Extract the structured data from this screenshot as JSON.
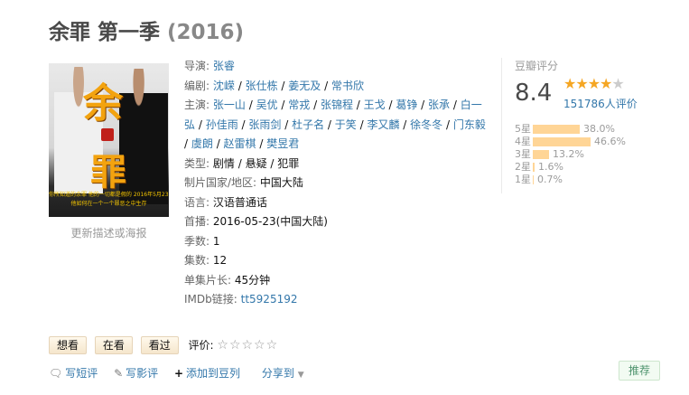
{
  "title": {
    "main": "余罪 第一季",
    "year": "(2016)"
  },
  "poster": {
    "glyph_top": "余",
    "glyph_bottom": "罪",
    "strip_line1": "你所知道的余罪 他的一切都是假的 2016年5月23日",
    "strip_line2": "他如何在一个一个罪恶之中生存",
    "link_text": "更新描述或海报"
  },
  "info": {
    "director_label": "导演:",
    "directors": [
      "张睿"
    ],
    "writer_label": "编剧:",
    "writers": [
      "沈嵘",
      "张仕栋",
      "姜无及",
      "常书欣"
    ],
    "cast_label": "主演:",
    "cast": [
      "张一山",
      "吴优",
      "常戎",
      "张锦程",
      "王戈",
      "葛铮",
      "张承",
      "白一弘",
      "孙佳雨",
      "张雨剑",
      "杜子名",
      "于笑",
      "李又麟",
      "徐冬冬",
      "门东毅",
      "虞朗",
      "赵雷棋",
      "樊昱君"
    ],
    "genre_label": "类型:",
    "genres": [
      "剧情",
      "悬疑",
      "犯罪"
    ],
    "country_label": "制片国家/地区:",
    "country": "中国大陆",
    "language_label": "语言:",
    "language": "汉语普通话",
    "premiere_label": "首播:",
    "premiere": "2016-05-23(中国大陆)",
    "seasons_label": "季数:",
    "seasons": "1",
    "episodes_label": "集数:",
    "episodes": "12",
    "runtime_label": "单集片长:",
    "runtime": "45分钟",
    "imdb_label": "IMDb链接:",
    "imdb": "tt5925192"
  },
  "rating": {
    "label": "豆瓣评分",
    "score": "8.4",
    "stars_filled": 4,
    "stars_total": 5,
    "count_text": "151786人评价",
    "distribution": [
      {
        "level": "5星",
        "percent": 38.0,
        "percent_text": "38.0%"
      },
      {
        "level": "4星",
        "percent": 46.6,
        "percent_text": "46.6%"
      },
      {
        "level": "3星",
        "percent": 13.2,
        "percent_text": "13.2%"
      },
      {
        "level": "2星",
        "percent": 1.6,
        "percent_text": "1.6%"
      },
      {
        "level": "1星",
        "percent": 0.7,
        "percent_text": "0.7%"
      }
    ]
  },
  "actions": {
    "want": "想看",
    "watching": "在看",
    "watched": "看过",
    "rate_label": "评价:",
    "rate_stars": "☆☆☆☆☆"
  },
  "bottom": {
    "short_review": "写短评",
    "review": "写影评",
    "add_to_list": "添加到豆列",
    "share": "分享到"
  },
  "recommend": "推荐",
  "colors": {
    "link": "#3377aa",
    "star": "#f5a623",
    "bar": "#ffd596"
  }
}
